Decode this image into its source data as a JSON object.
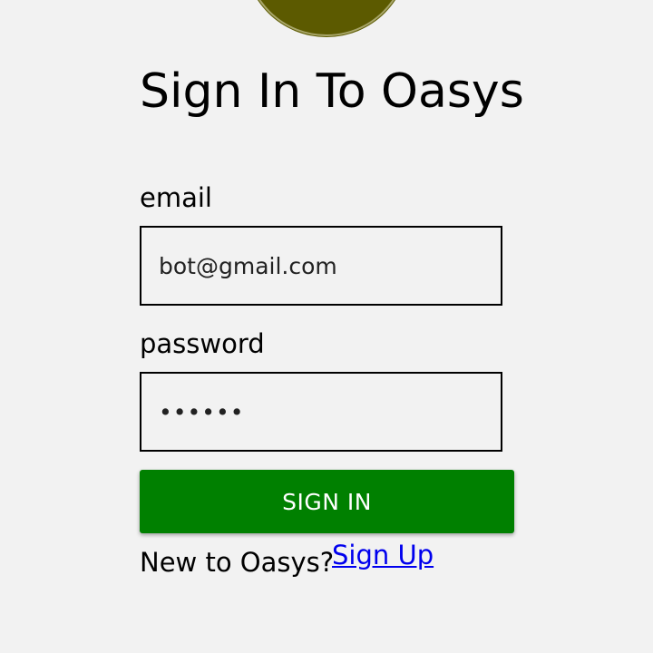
{
  "logo": {
    "icon": "logo-circle",
    "color": "#5c5a00"
  },
  "page": {
    "title": "Sign In To Oasys"
  },
  "form": {
    "email_label": "email",
    "email_value": "bot@gmail.com",
    "password_label": "password",
    "password_value": "••••••",
    "submit_label": "SIGN IN",
    "submit_color": "#008000"
  },
  "footer": {
    "prompt": "New to Oasys?",
    "signup_label": "Sign Up"
  }
}
